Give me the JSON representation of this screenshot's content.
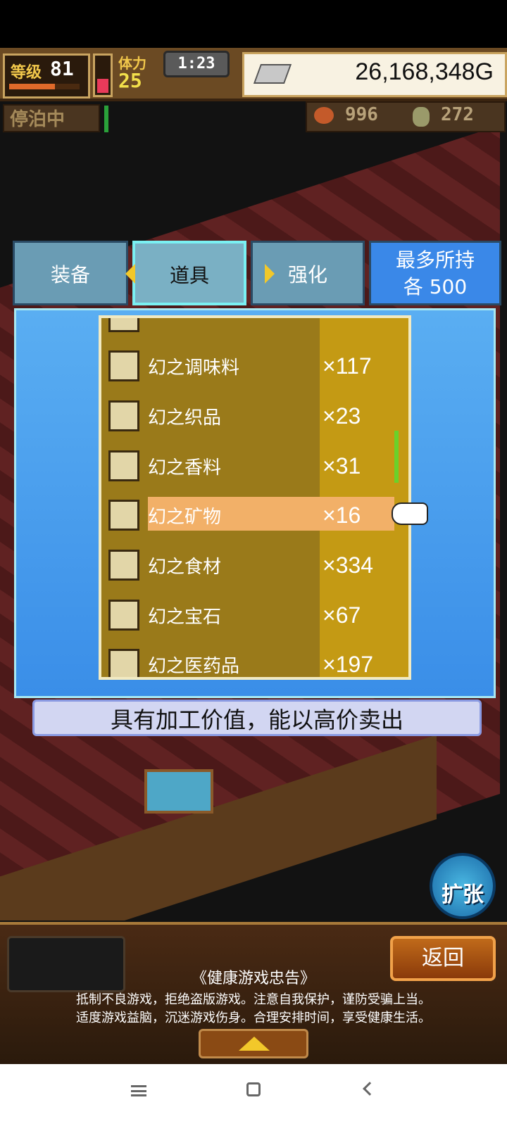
{
  "hud": {
    "level_label": "等级",
    "level": "81",
    "stamina_label": "体力",
    "stamina": "25",
    "time": "1:23",
    "money": "26,168,348G",
    "dock_status": "停泊中",
    "resource_1": "996",
    "resource_2": "272"
  },
  "tabs": [
    {
      "label": "装备"
    },
    {
      "label": "道具"
    },
    {
      "label": "强化"
    }
  ],
  "max_hold": {
    "line1": "最多所持",
    "line2": "各 500"
  },
  "items": [
    {
      "name": "幻之调味料",
      "count": "×117",
      "icon": "bottle-icon"
    },
    {
      "name": "幻之织品",
      "count": "×23",
      "icon": "fabric-icon"
    },
    {
      "name": "幻之香料",
      "count": "×31",
      "icon": "flower-spice-icon"
    },
    {
      "name": "幻之矿物",
      "count": "×16",
      "icon": "mineral-rock-icon",
      "selected": true
    },
    {
      "name": "幻之食材",
      "count": "×334",
      "icon": "bread-icon"
    },
    {
      "name": "幻之宝石",
      "count": "×67",
      "icon": "gem-icon"
    },
    {
      "name": "幻之医药品",
      "count": "×197",
      "icon": "herb-icon"
    }
  ],
  "description": "具有加工价值，能以高价卖出",
  "expand_label": "扩张",
  "back_label": "返回",
  "notice": {
    "title": "《健康游戏忠告》",
    "line1": "抵制不良游戏，拒绝盗版游戏。注意自我保护，谨防受骗上当。",
    "line2": "适度游戏益脑，沉迷游戏伤身。合理安排时间，享受健康生活。"
  },
  "colors": {
    "panel": "#3a8ee8",
    "list_bg": "#9a7a1a",
    "highlight": "#f2b068",
    "tab_active_border": "#7af0f2"
  }
}
